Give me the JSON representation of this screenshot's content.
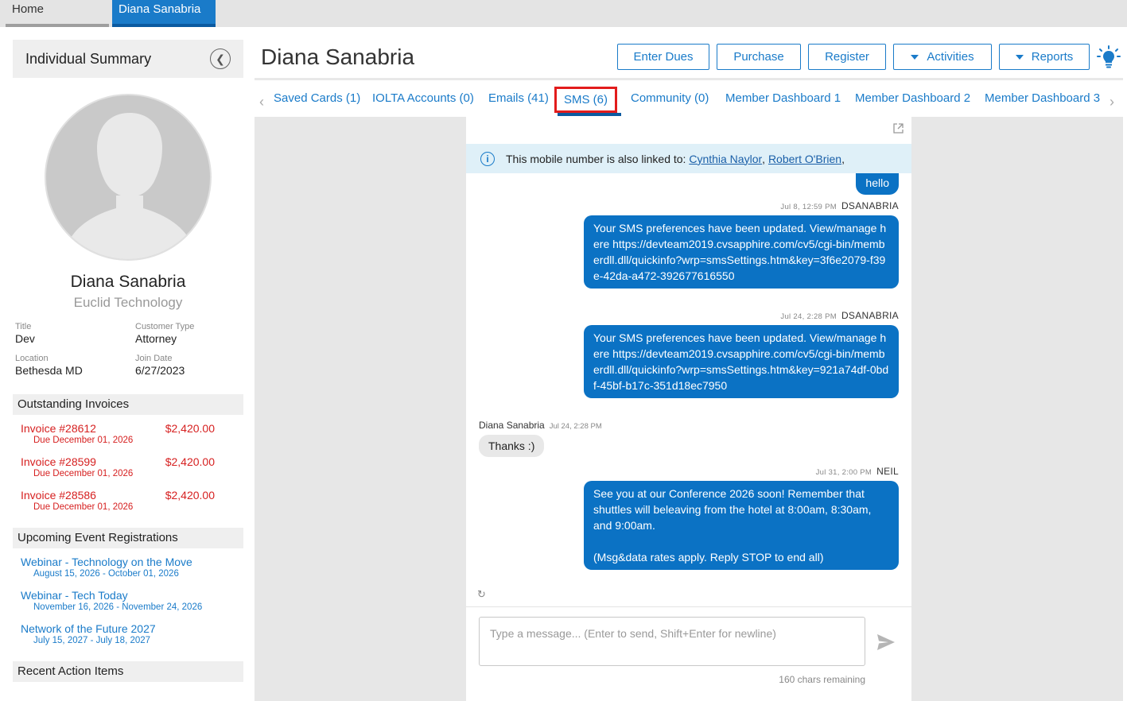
{
  "top_tabs": {
    "home": "Home",
    "active": "Diana Sanabria"
  },
  "sidebar": {
    "header": "Individual Summary",
    "name": "Diana Sanabria",
    "company": "Euclid Technology",
    "fields": {
      "title_label": "Title",
      "title_value": "Dev",
      "ctype_label": "Customer Type",
      "ctype_value": "Attorney",
      "location_label": "Location",
      "location_value": "Bethesda MD",
      "join_label": "Join Date",
      "join_value": "6/27/2023"
    },
    "invoices_header": "Outstanding Invoices",
    "invoices": [
      {
        "number": "Invoice #28612",
        "amount": "$2,420.00",
        "due": "Due December 01, 2026"
      },
      {
        "number": "Invoice #28599",
        "amount": "$2,420.00",
        "due": "Due December 01, 2026"
      },
      {
        "number": "Invoice #28586",
        "amount": "$2,420.00",
        "due": "Due December 01, 2026"
      }
    ],
    "events_header": "Upcoming Event Registrations",
    "events": [
      {
        "name": "Webinar - Technology on the Move",
        "dates": "August 15, 2026 - October 01, 2026"
      },
      {
        "name": "Webinar - Tech Today",
        "dates": "November 16, 2026 - November 24, 2026"
      },
      {
        "name": "Network of the Future 2027",
        "dates": "July 15, 2027 - July 18, 2027"
      }
    ],
    "actions_header": "Recent Action Items"
  },
  "main": {
    "title": "Diana Sanabria",
    "buttons": {
      "dues": "Enter Dues",
      "purchase": "Purchase",
      "register": "Register",
      "activities": "Activities",
      "reports": "Reports"
    },
    "subtabs": {
      "saved_cards": "Saved Cards (1)",
      "iolta": "IOLTA Accounts (0)",
      "emails": "Emails (41)",
      "sms": "SMS (6)",
      "community": "Community (0)",
      "dash1": "Member Dashboard 1",
      "dash2": "Member Dashboard 2",
      "dash3": "Member Dashboard 3"
    }
  },
  "sms": {
    "info_text": "This mobile number is also linked to:",
    "linked_1": "Cynthia Naylor",
    "linked_2": "Robert O'Brien",
    "linked_sep": ",",
    "messages": [
      {
        "text": "hello"
      },
      {
        "time": "Jul 8, 12:59 PM",
        "sender": "DSANABRIA",
        "text": "Your SMS preferences have been updated. View/manage here https://devteam2019.cvsapphire.com/cv5/cgi-bin/memberdll.dll/quickinfo?wrp=smsSettings.htm&key=3f6e2079-f39e-42da-a472-392677616550"
      },
      {
        "time": "Jul 24, 2:28 PM",
        "sender": "DSANABRIA",
        "text": "Your SMS preferences have been updated. View/manage here https://devteam2019.cvsapphire.com/cv5/cgi-bin/memberdll.dll/quickinfo?wrp=smsSettings.htm&key=921a74df-0bdf-45bf-b17c-351d18ec7950"
      },
      {
        "sender": "Diana Sanabria",
        "time": "Jul 24, 2:28 PM",
        "text": "Thanks :)"
      },
      {
        "time": "Jul 31, 2:00 PM",
        "sender": "NEIL",
        "text": "See you at our Conference 2026 soon! Remember that shuttles will beleaving from the hotel at 8:00am, 8:30am, and 9:00am.",
        "text2": "(Msg&data rates apply. Reply STOP to end all)"
      }
    ],
    "placeholder": "Type a message... (Enter to send, Shift+Enter for newline)",
    "remaining": "160 chars remaining"
  },
  "colors": {
    "accent": "#1a7bc9",
    "bubble": "#0b72c4",
    "invoice": "#d62020",
    "highlight": "#e21c1c"
  }
}
